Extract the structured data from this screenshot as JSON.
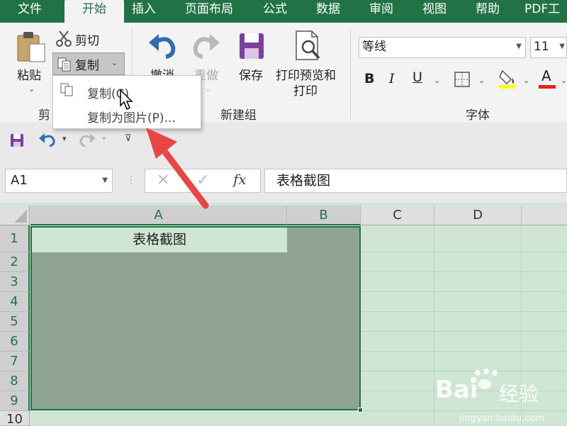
{
  "tabs": [
    "文件",
    "开始",
    "插入",
    "页面布局",
    "公式",
    "数据",
    "审阅",
    "视图",
    "帮助",
    "PDF工"
  ],
  "active_tab": "开始",
  "clipboard": {
    "paste_label": "粘贴",
    "cut_label": "剪切",
    "copy_label": "复制",
    "group_label": "剪"
  },
  "new_group": {
    "undo_label": "撤消",
    "redo_label": "重做",
    "save_label": "保存",
    "print_preview_label_line1": "打印预览和",
    "print_preview_label_line2": "打印",
    "group_label": "新建组"
  },
  "font": {
    "font_name": "等线",
    "font_size": "11",
    "bold": "B",
    "italic": "I",
    "underline": "U",
    "font_color_letter": "A",
    "group_label": "字体"
  },
  "copy_menu": {
    "items": [
      "复制(C)",
      "复制为图片(P)..."
    ]
  },
  "formula_bar": {
    "name_box": "A1",
    "fx": "fx",
    "value": "表格截图"
  },
  "grid": {
    "columns": [
      "A",
      "B",
      "C",
      "D"
    ],
    "rows": [
      "1",
      "2",
      "3",
      "4",
      "5",
      "6",
      "7",
      "8",
      "9",
      "10"
    ],
    "a1_value": "表格截图"
  },
  "watermark": {
    "brand": "Bai",
    "brand_suffix": "经验",
    "url": "jingyan.baidu.com"
  },
  "colors": {
    "accent": "#217346",
    "arrow": "#e84545",
    "selection": "#8fa391",
    "sheet_bg": "#cfe6d4"
  }
}
